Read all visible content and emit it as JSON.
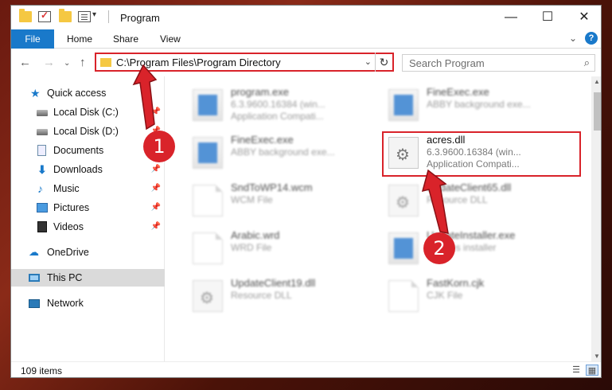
{
  "window": {
    "title": "Program",
    "minimize_glyph": "—",
    "maximize_glyph": "☐",
    "close_glyph": "✕"
  },
  "ribbon": {
    "tabs": [
      "File",
      "Home",
      "Share",
      "View"
    ],
    "expand_glyph": "⌄",
    "help_glyph": "?"
  },
  "navigation": {
    "back_glyph": "←",
    "forward_glyph": "→",
    "recent_glyph": "⌄",
    "up_glyph": "↑",
    "address": "C:\\Program Files\\Program Directory",
    "address_dropdown_glyph": "⌄",
    "refresh_glyph": "↻",
    "search_placeholder": "Search Program",
    "search_glyph": "⌕"
  },
  "sidebar": {
    "items": [
      {
        "label": "Quick access",
        "icon": "star-icon",
        "pinned": false
      },
      {
        "label": "Local Disk (C:)",
        "icon": "drive-icon",
        "pinned": true
      },
      {
        "label": "Local Disk (D:)",
        "icon": "drive-icon",
        "pinned": true
      },
      {
        "label": "Documents",
        "icon": "documents-icon",
        "pinned": true
      },
      {
        "label": "Downloads",
        "icon": "downloads-icon",
        "pinned": true
      },
      {
        "label": "Music",
        "icon": "music-icon",
        "pinned": true
      },
      {
        "label": "Pictures",
        "icon": "pictures-icon",
        "pinned": true
      },
      {
        "label": "Videos",
        "icon": "videos-icon",
        "pinned": true
      },
      {
        "label": "OneDrive",
        "icon": "onedrive-icon",
        "pinned": false
      },
      {
        "label": "This PC",
        "icon": "this-pc-icon",
        "pinned": false,
        "selected": true
      },
      {
        "label": "Network",
        "icon": "network-icon",
        "pinned": false
      }
    ]
  },
  "files": [
    {
      "name": "program.exe",
      "line1": "6.3.9600.16384 (win...",
      "line2": "Application Compati...",
      "type": "exe"
    },
    {
      "name": "FineExec.exe",
      "line1": "ABBY background exe...",
      "line2": "",
      "type": "exe"
    },
    {
      "name": "FineExec.exe",
      "line1": "ABBY background exe...",
      "line2": "",
      "type": "exe"
    },
    {
      "name": "acres.dll",
      "line1": "6.3.9600.16384 (win...",
      "line2": "Application Compati...",
      "type": "dll",
      "highlighted": true
    },
    {
      "name": "SndToWP14.wcm",
      "line1": "WCM File",
      "line2": "",
      "type": "doc"
    },
    {
      "name": "UpdateClient65.dll",
      "line1": "Resource DLL",
      "line2": "",
      "type": "dll"
    },
    {
      "name": "Arabic.wrd",
      "line1": "WRD File",
      "line2": "",
      "type": "doc"
    },
    {
      "name": "UpdateInstaller.exe",
      "line1": "updates installer",
      "line2": "",
      "type": "exe"
    },
    {
      "name": "UpdateClient19.dll",
      "line1": "Resource DLL",
      "line2": "",
      "type": "dll"
    },
    {
      "name": "FastKorn.cjk",
      "line1": "CJK File",
      "line2": "",
      "type": "doc"
    }
  ],
  "status": {
    "item_count": "109 items",
    "details_view_glyph": "☰",
    "large_icons_glyph": "▦"
  },
  "annotations": {
    "marker_1": "1",
    "marker_2": "2",
    "accent_color": "#d9232a"
  },
  "pin_glyph": "📌"
}
